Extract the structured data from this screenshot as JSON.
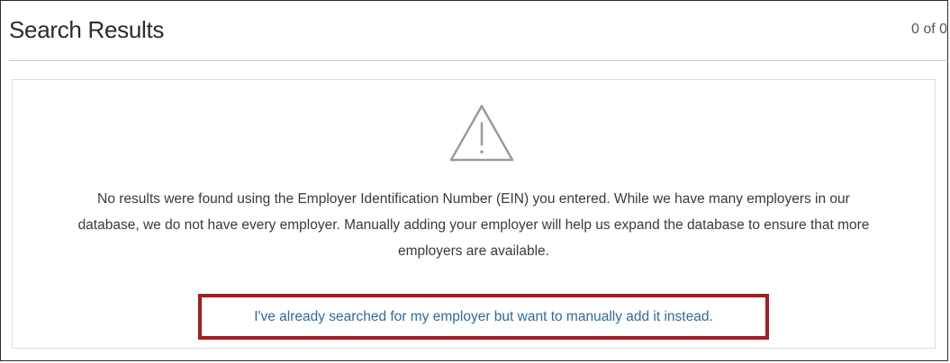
{
  "header": {
    "title": "Search Results",
    "count": "0 of 0"
  },
  "results": {
    "icon": "warning-triangle-icon",
    "message": "No results were found using the Employer Identification Number (EIN) you entered. While we have many employers in our database, we do not have every employer. Manually adding your employer will help us expand the database to ensure that more employers are available.",
    "manual_add_link": "I've already searched for my employer but want to manually add it instead."
  },
  "colors": {
    "link": "#2b6c9e",
    "highlight_border": "#a51d21",
    "icon_stroke": "#9a9a9a"
  }
}
